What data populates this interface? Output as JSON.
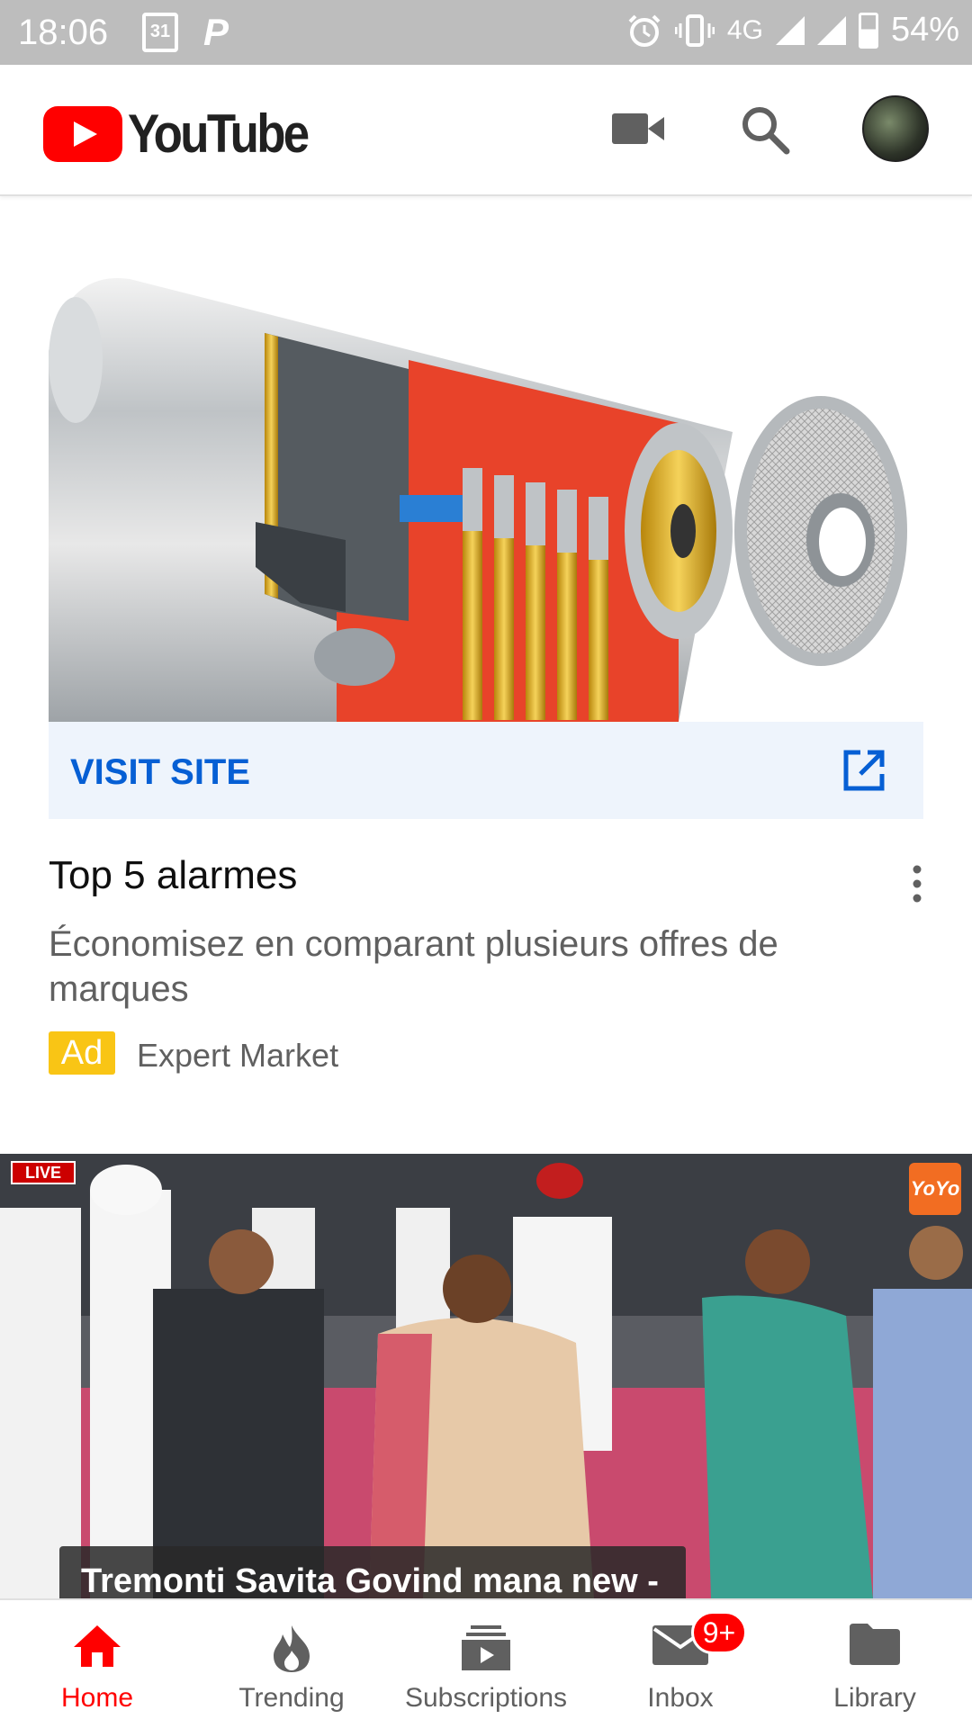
{
  "status_bar": {
    "time": "18:06",
    "calendar_day": "31",
    "network": "4G",
    "battery": "54%"
  },
  "header": {
    "logo_text": "YouTube"
  },
  "ad": {
    "visit_label": "VISIT SITE",
    "title": "Top 5 alarmes",
    "description": "Économisez en comparant plusieurs offres de marques",
    "badge": "Ad",
    "advertiser": "Expert Market"
  },
  "video": {
    "live_label": "LIVE",
    "channel_logo": "YoYo",
    "title": "Tremonti Savita Govind mana new -"
  },
  "bottom_nav": {
    "items": [
      {
        "label": "Home",
        "icon": "home-icon",
        "active": true
      },
      {
        "label": "Trending",
        "icon": "flame-icon",
        "active": false
      },
      {
        "label": "Subscriptions",
        "icon": "subscriptions-icon",
        "active": false
      },
      {
        "label": "Inbox",
        "icon": "mail-icon",
        "active": false,
        "badge": "9+"
      },
      {
        "label": "Library",
        "icon": "folder-icon",
        "active": false
      }
    ]
  },
  "colors": {
    "brand_red": "#ff0000",
    "link_blue": "#065fd4",
    "ad_yellow": "#f9c515"
  }
}
